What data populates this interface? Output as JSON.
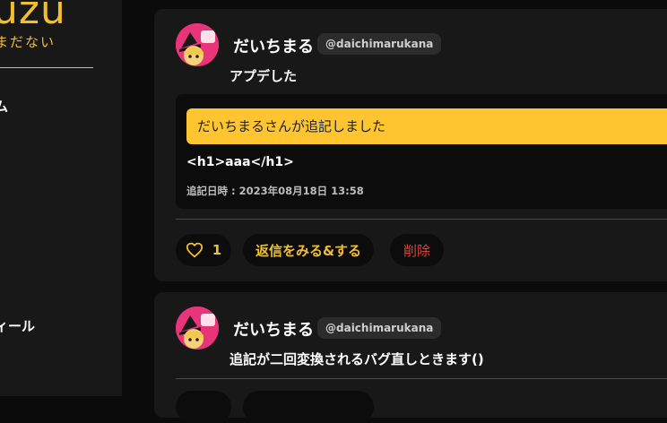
{
  "sidebar": {
    "logo_text": "uzu",
    "tagline": "まだない",
    "nav_items": [
      {
        "label": "ム"
      },
      {
        "label": "ィール"
      }
    ]
  },
  "posts": [
    {
      "username": "だいちまる",
      "handle": "@daichimarukana",
      "text": "アプデした",
      "addendum": {
        "banner": "だいちまるさんが追記しました",
        "body": "<h1>aaa</h1>",
        "timestamp": "追記日時 : 2023年08月18日 13:58"
      },
      "actions": {
        "like_count": "1",
        "reply_label": "返信をみる&する",
        "delete_label": "削除"
      }
    },
    {
      "username": "だいちまる",
      "handle": "@daichimarukana",
      "text": "追記が二回変換されるバグ直しときます()"
    }
  ],
  "colors": {
    "accent": "#f2be2e",
    "banner": "#ffc531",
    "danger": "#e0443a",
    "card": "#181818",
    "page": "#0b0b0b"
  },
  "icons": {
    "like": "heart-icon",
    "avatar": "avatar-image"
  }
}
